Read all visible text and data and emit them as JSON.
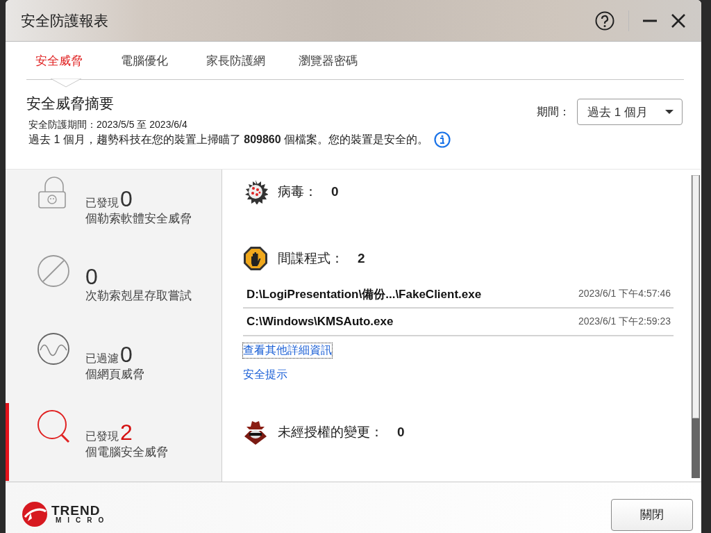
{
  "window": {
    "title": "安全防護報表"
  },
  "tabs": [
    {
      "label": "安全威脅",
      "selected": true
    },
    {
      "label": "電腦優化",
      "selected": false
    },
    {
      "label": "家長防護網",
      "selected": false
    },
    {
      "label": "瀏覽器密碼",
      "selected": false
    }
  ],
  "summary": {
    "heading": "安全威脅摘要",
    "period_text": "安全防護期間：2023/5/5 至 2023/6/4",
    "description": "過去 1 個月，趨勢科技在您的裝置上掃瞄了 **809860** 個檔案。您的裝置是安全的。",
    "period_label": "期間：",
    "period_value": "過去 1 個月"
  },
  "sidebar": {
    "items": [
      {
        "kind": "lock",
        "prefix": "已發現",
        "count": "0",
        "label": "個勒索軟體安全威脅",
        "selected": false
      },
      {
        "kind": "blocked",
        "count": "0",
        "label": "次勒索剋星存取嘗試",
        "selected": false
      },
      {
        "kind": "wave",
        "prefix": "已過濾",
        "count": "0",
        "label": "個網頁威脅",
        "selected": false
      },
      {
        "kind": "search",
        "prefix": "已發現",
        "count": "2",
        "label": "個電腦安全威脅",
        "selected": true
      }
    ]
  },
  "details": {
    "sections": [
      {
        "kind": "virus",
        "label": "病毒：",
        "count": "0"
      },
      {
        "kind": "spyware",
        "label": "間諜程式：",
        "count": "2",
        "files": [
          {
            "path": "D:\\LogiPresentation\\備份...\\FakeClient.exe",
            "time": "2023/6/1 下午4:57:46"
          },
          {
            "path": "C:\\Windows\\KMSAuto.exe",
            "time": "2023/6/1 下午2:59:23"
          }
        ],
        "links": [
          "查看其他詳細資訊",
          "安全提示"
        ]
      },
      {
        "kind": "hacker",
        "label": "未經授權的變更：",
        "count": "0"
      }
    ]
  },
  "footer": {
    "logo": [
      "TREND",
      "MICRO"
    ],
    "button": "關閉"
  }
}
